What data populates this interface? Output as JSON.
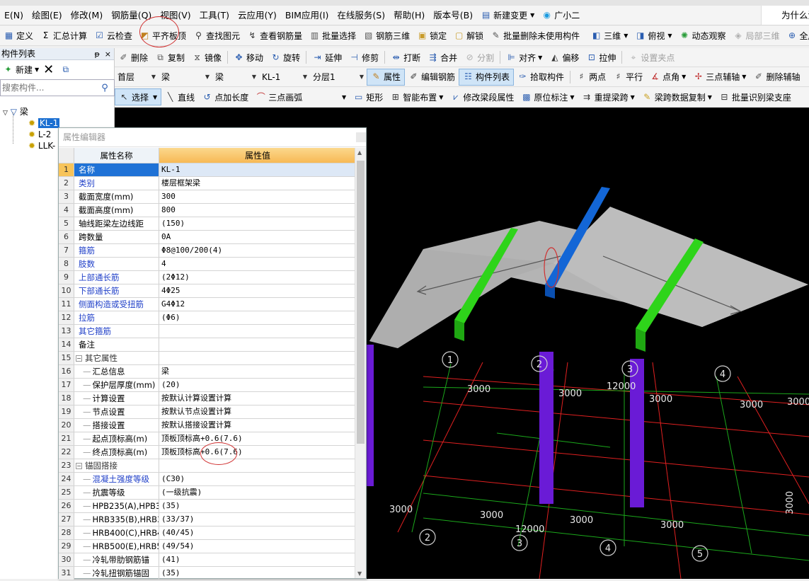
{
  "menubar": {
    "items": [
      "E(N)",
      "绘图(E)",
      "修改(M)",
      "钢筋量(Q)",
      "视图(V)",
      "工具(T)",
      "云应用(Y)",
      "BIM应用(I)",
      "在线服务(S)",
      "帮助(H)",
      "版本号(B)"
    ],
    "new_change": "新建变更",
    "assistant": "广小二",
    "right_text": "为什么没"
  },
  "toolbar1": {
    "items": [
      "定义",
      "汇总计算",
      "云检查",
      "平齐板顶",
      "查找图元",
      "查看钢筋量",
      "批量选择",
      "钢筋三维",
      "锁定",
      "解锁",
      "批量删除未使用构件"
    ],
    "view_3d": "三维",
    "view_top": "俯视",
    "dynamic_view": "动态观察",
    "local_3d": "局部三维",
    "fullscreen": "全屏"
  },
  "toolbar2": {
    "items": [
      "删除",
      "复制",
      "镜像",
      "移动",
      "旋转",
      "延伸",
      "修剪",
      "打断",
      "合并",
      "分割",
      "对齐",
      "偏移",
      "拉伸",
      "设置夹点"
    ]
  },
  "toolbar3": {
    "floor": "首层",
    "type1": "梁",
    "type2": "梁",
    "component": "KL-1",
    "layer": "分层1",
    "items": [
      "属性",
      "编辑钢筋",
      "构件列表",
      "拾取构件",
      "两点",
      "平行",
      "点角",
      "三点辅轴",
      "删除辅轴"
    ]
  },
  "toolbar4": {
    "items": [
      "选择",
      "直线",
      "点加长度",
      "三点画弧",
      "矩形",
      "智能布置",
      "修改梁段属性",
      "原位标注",
      "重提梁跨",
      "梁跨数据复制",
      "批量识别梁支座"
    ]
  },
  "leftpanel": {
    "title": "构件列表",
    "pin": "ᵽ",
    "close": "×",
    "new_button": "新建",
    "search_placeholder": "搜索构件...",
    "tree_root": "梁",
    "tree_items": [
      "KL-1",
      "L-2",
      "LLK-"
    ]
  },
  "property_editor": {
    "title": "属性编辑器",
    "col_name": "属性名称",
    "col_value": "属性值",
    "rows": [
      {
        "n": "1",
        "name": "名称",
        "value": "KL-1"
      },
      {
        "n": "2",
        "name": "类别",
        "value": "楼层框架梁"
      },
      {
        "n": "3",
        "name": "截面宽度(mm)",
        "value": "300"
      },
      {
        "n": "4",
        "name": "截面高度(mm)",
        "value": "800"
      },
      {
        "n": "5",
        "name": "轴线距梁左边线距",
        "value": "(150)"
      },
      {
        "n": "6",
        "name": "跨数量",
        "value": "0A"
      },
      {
        "n": "7",
        "name": "箍筋",
        "value": "Φ8@100/200(4)"
      },
      {
        "n": "8",
        "name": "肢数",
        "value": "4"
      },
      {
        "n": "9",
        "name": "上部通长筋",
        "value": "(2Φ12)"
      },
      {
        "n": "10",
        "name": "下部通长筋",
        "value": "4Φ25"
      },
      {
        "n": "11",
        "name": "侧面构造或受扭筋",
        "value": "G4Φ12"
      },
      {
        "n": "12",
        "name": "拉筋",
        "value": "(Φ6)"
      },
      {
        "n": "13",
        "name": "其它箍筋",
        "value": ""
      },
      {
        "n": "14",
        "name": "备注",
        "value": ""
      },
      {
        "n": "15",
        "name": "其它属性",
        "value": ""
      },
      {
        "n": "16",
        "name": "汇总信息",
        "value": "梁"
      },
      {
        "n": "17",
        "name": "保护层厚度(mm)",
        "value": "(20)"
      },
      {
        "n": "18",
        "name": "计算设置",
        "value": "按默认计算设置计算"
      },
      {
        "n": "19",
        "name": "节点设置",
        "value": "按默认节点设置计算"
      },
      {
        "n": "20",
        "name": "搭接设置",
        "value": "按默认搭接设置计算"
      },
      {
        "n": "21",
        "name": "起点顶标高(m)",
        "value": "顶板顶标高+0.6(7.6)"
      },
      {
        "n": "22",
        "name": "终点顶标高(m)",
        "value": "顶板顶标高+0.6(7.6)"
      },
      {
        "n": "23",
        "name": "锚固搭接",
        "value": ""
      },
      {
        "n": "24",
        "name": "混凝土强度等级",
        "value": "(C30)"
      },
      {
        "n": "25",
        "name": "抗震等级",
        "value": "(一级抗震)"
      },
      {
        "n": "26",
        "name": "HPB235(A),HPB3",
        "value": "(35)"
      },
      {
        "n": "27",
        "name": "HRB335(B),HRB3",
        "value": "(33/37)"
      },
      {
        "n": "28",
        "name": "HRB400(C),HRB4",
        "value": "(40/45)"
      },
      {
        "n": "29",
        "name": "HRB500(E),HRB5",
        "value": "(49/54)"
      },
      {
        "n": "30",
        "name": "冷轧带肋钢筋锚",
        "value": "(41)"
      },
      {
        "n": "31",
        "name": "冷轧扭钢筋锚固",
        "value": "(35)"
      }
    ]
  },
  "viewport": {
    "axis_labels": [
      "1",
      "2",
      "3",
      "4",
      "2",
      "3",
      "4",
      "5"
    ],
    "dimensions": [
      "3000",
      "3000",
      "12000",
      "3000",
      "3000",
      "3000",
      "3000",
      "3000",
      "12000",
      "3000",
      "3000",
      "3000"
    ]
  },
  "colors": {
    "selection_blue": "#1f72d6",
    "header_orange": "#f7b955",
    "column_purple": "#6a1bd6",
    "beam_green": "#2ed41a",
    "beam_blue": "#1366d6",
    "slab_gray": "#b4b4b4"
  }
}
